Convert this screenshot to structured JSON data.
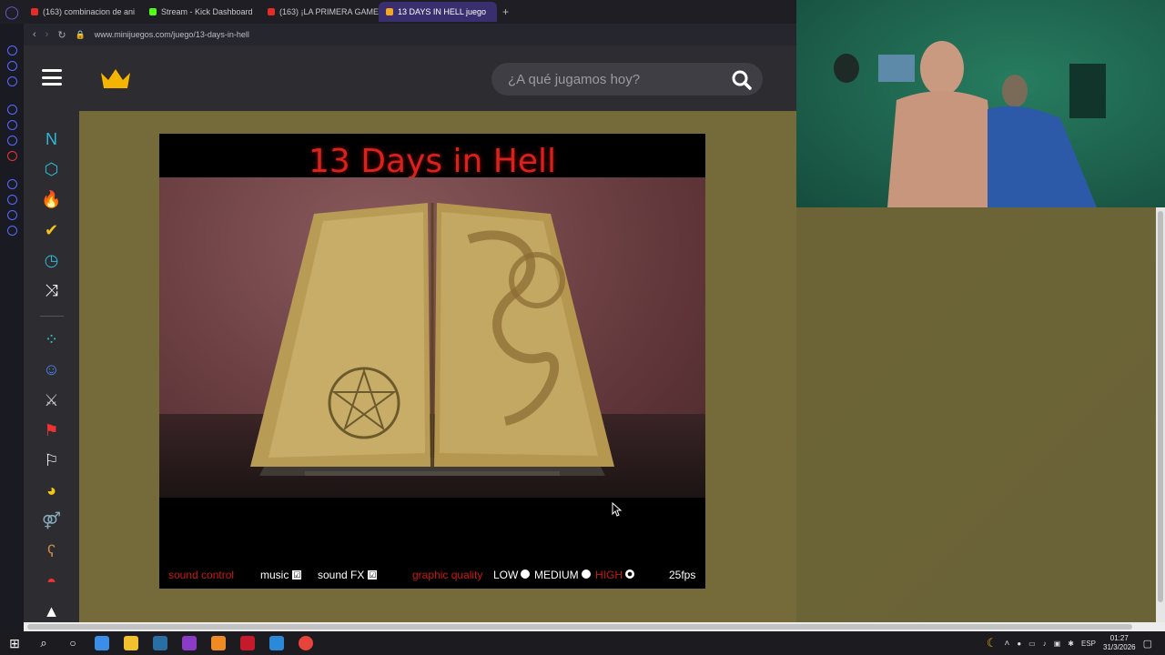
{
  "browser": {
    "tabs": [
      {
        "label": "(163) combinacion de ani",
        "color": "#e52d27"
      },
      {
        "label": "Stream - Kick Dashboard",
        "color": "#53fc18"
      },
      {
        "label": "(163) ¡LA PRIMERA GAME",
        "color": "#e52d27"
      },
      {
        "label": "13 DAYS IN HELL juego",
        "color": "#f5a623",
        "active": true
      }
    ],
    "add_tab": "+",
    "url": "www.minijuegos.com/juego/13-days-in-hell"
  },
  "site": {
    "search_placeholder": "¿A qué jugamos hoy?",
    "categories": [
      {
        "name": "nuevos-icon",
        "glyph": "N",
        "color": "#2fb9d6"
      },
      {
        "name": "hexagon-icon",
        "glyph": "⬡",
        "color": "#2fb9d6"
      },
      {
        "name": "fire-icon",
        "glyph": "🔥",
        "color": "#e33"
      },
      {
        "name": "check-icon",
        "glyph": "✔",
        "color": "#f3c316"
      },
      {
        "name": "speed-icon",
        "glyph": "◷",
        "color": "#2fb9d6"
      },
      {
        "name": "shuffle-icon",
        "glyph": "⤨",
        "color": "#fff"
      },
      {
        "name": "dots-icon",
        "glyph": "⁘",
        "color": "#3cc"
      },
      {
        "name": "people-icon",
        "glyph": "☺",
        "color": "#4b8bef"
      },
      {
        "name": "swords-icon",
        "glyph": "⚔",
        "color": "#ccc"
      },
      {
        "name": "flag-icon",
        "glyph": "⚑",
        "color": "#e33"
      },
      {
        "name": "race-flag-icon",
        "glyph": "⚐",
        "color": "#fff"
      },
      {
        "name": "pacman-icon",
        "glyph": "◕",
        "color": "#f5c518"
      },
      {
        "name": "couple-icon",
        "glyph": "⚤",
        "color": "#8ab"
      },
      {
        "name": "bear-icon",
        "glyph": "ʕ",
        "color": "#c98a4b"
      },
      {
        "name": "pokeball-icon",
        "glyph": "◓",
        "color": "#e33"
      },
      {
        "name": "more-icon",
        "glyph": "▲",
        "color": "#fff"
      }
    ]
  },
  "game": {
    "title": "13 Days in Hell",
    "controls": {
      "sound_control": "sound control",
      "music": "music",
      "music_checked": "☑",
      "sound_fx": "sound FX",
      "sound_fx_checked": "☑",
      "graphic_quality": "graphic quality",
      "low": "LOW",
      "medium": "MEDIUM",
      "high": "HIGH",
      "selected_quality": "HIGH",
      "fps": "25fps"
    }
  },
  "taskbar": {
    "lang": "ESP",
    "time": "01:27",
    "date": "31/3/2026"
  }
}
